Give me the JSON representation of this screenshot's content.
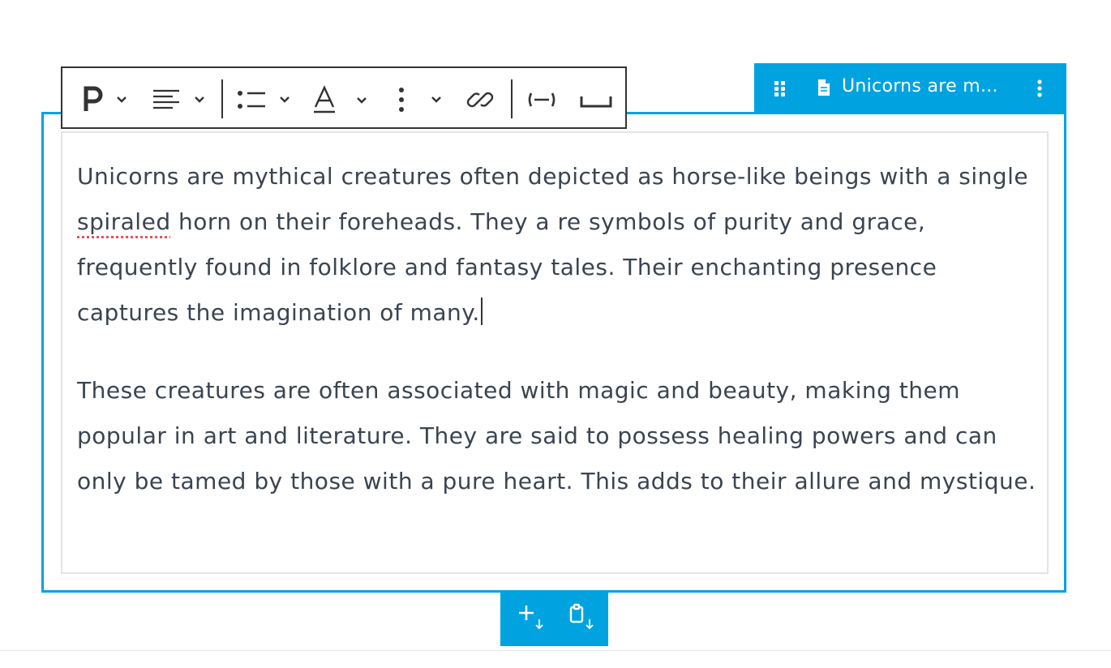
{
  "colors": {
    "accent": "#00a3e0",
    "text": "#3a4450",
    "toolbar_border": "#333333"
  },
  "toolbar": {
    "paragraph_icon": "paragraph-p-icon",
    "align_icon": "align-left-icon",
    "list_icon": "list-icon",
    "text_color_icon": "text-color-a-icon",
    "more_icon": "more-vertical-icon",
    "link_icon": "link-icon",
    "nonbreaking_icon": "nonbreaking-hyphen-icon",
    "space_icon": "nonbreaking-space-icon"
  },
  "block_tab": {
    "drag_icon": "drag-handle-icon",
    "doc_icon": "document-icon",
    "title": "Unicorns are m...",
    "more_icon": "more-vertical-icon"
  },
  "content": {
    "p1_a": "Unicorns are mythical creatures often depicted as horse-like beings with a single ",
    "p1_spell": "spiraled",
    "p1_b": " horn on their foreheads. They a re symbols of purity and grace, frequently found in folklore and fantasy tales. Their enchanting presence captures the imagination of many.",
    "p2": "These creatures are often associated with magic and beauty, making them popular in art and literature. They are said to possess healing powers and can only be tamed by those with a pure heart. This adds to their allure and mystique."
  },
  "inserter": {
    "add_icon": "add-below-icon",
    "paste_icon": "paste-below-icon"
  }
}
